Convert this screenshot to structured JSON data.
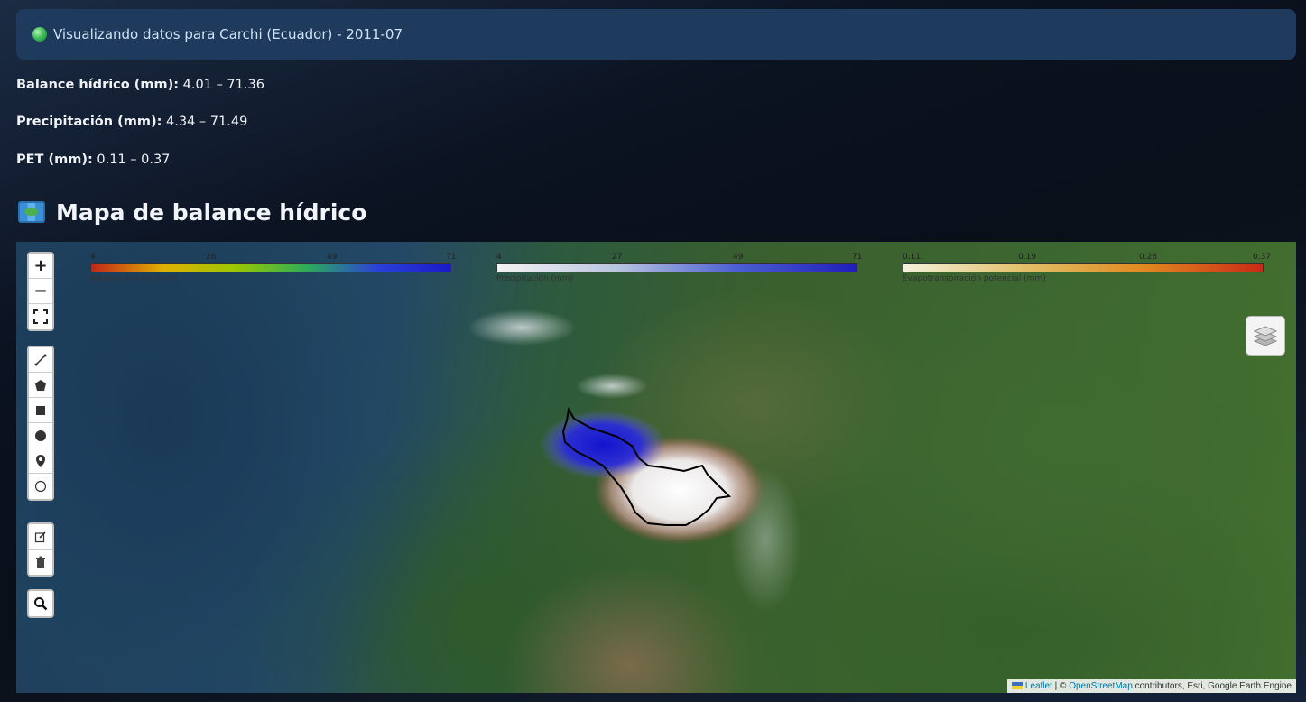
{
  "banner": {
    "text": "Visualizando datos para Carchi (Ecuador) - 2011-07"
  },
  "stats": [
    {
      "label": "Balance hídrico (mm):",
      "value": "4.01 – 71.36"
    },
    {
      "label": "Precipitación (mm):",
      "value": "4.34 – 71.49"
    },
    {
      "label": "PET (mm):",
      "value": "0.11 – 0.37"
    }
  ],
  "section": {
    "title": "Mapa de balance hídrico",
    "icon": "world-map-icon"
  },
  "legends": [
    {
      "ticks": [
        "4",
        "26",
        "49",
        "71"
      ],
      "caption": "Balance hídrico (mm)",
      "colors": [
        "#c0261a",
        "#e0b000",
        "#9bc800",
        "#2dac5a",
        "#2b3fd8",
        "#1a1ac8"
      ]
    },
    {
      "ticks": [
        "4",
        "27",
        "49",
        "71"
      ],
      "caption": "Precipitación (mm)",
      "colors": [
        "#f3f3f3",
        "#b8c4e0",
        "#4c5fd0",
        "#1f1fb8"
      ]
    },
    {
      "ticks": [
        "0.11",
        "0.19",
        "0.28",
        "0.37"
      ],
      "caption": "Evapotranspiración potencial (mm)",
      "colors": [
        "#f5f0dc",
        "#e0c06a",
        "#e08a20",
        "#c82a16"
      ]
    }
  ],
  "map_controls": {
    "zoom_in": "+",
    "zoom_out": "−",
    "tools": [
      "polyline-icon",
      "polygon-icon",
      "rectangle-icon",
      "circle-icon",
      "marker-icon",
      "circlemarker-icon"
    ],
    "edit": [
      "edit-icon",
      "delete-icon"
    ],
    "search": "search-icon",
    "layers": "layers-icon"
  },
  "attribution": {
    "leaflet": "Leaflet",
    "sep": " | © ",
    "osm": "OpenStreetMap",
    "rest": " contributors, Esri, Google Earth Engine"
  }
}
